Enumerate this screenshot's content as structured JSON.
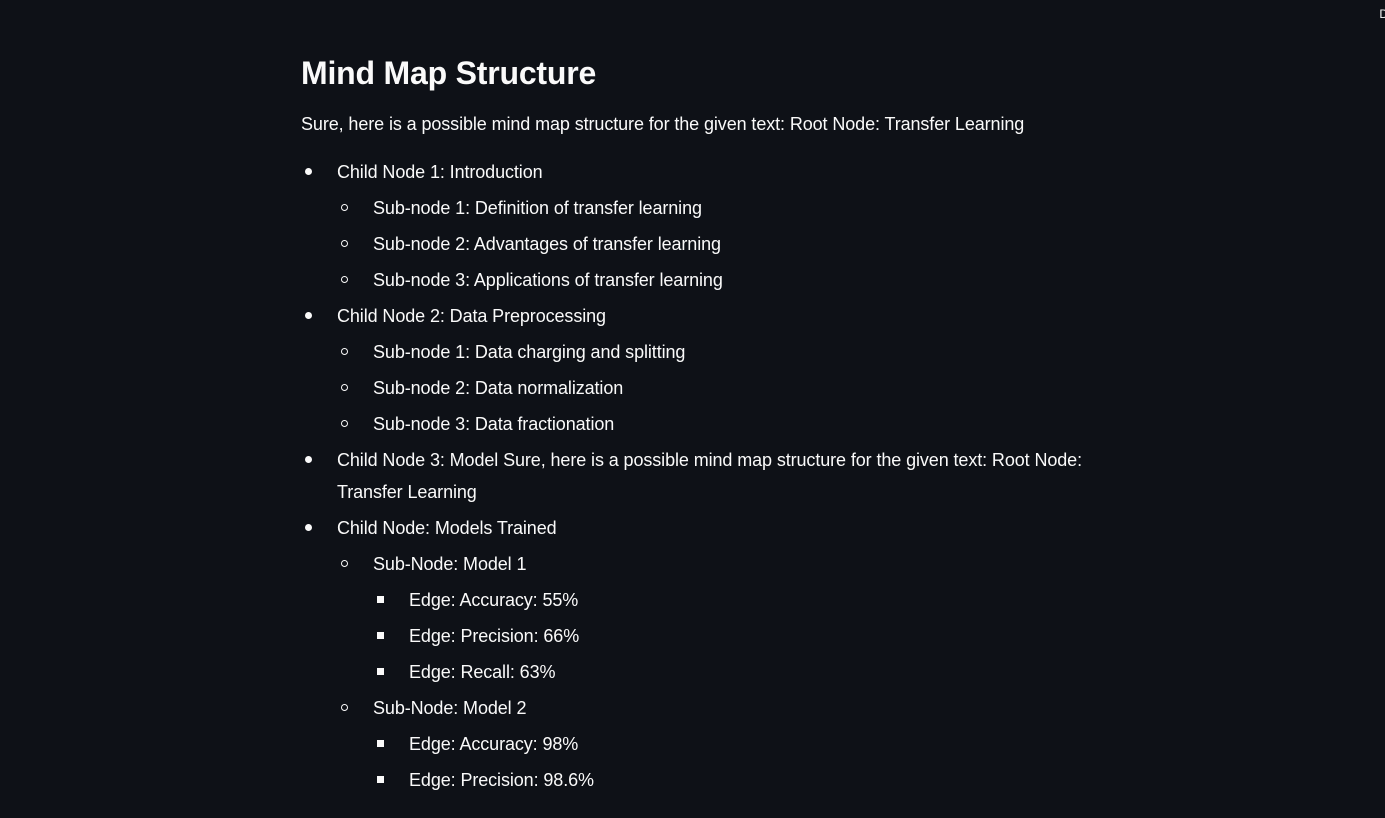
{
  "corner_glyph": "D",
  "title": "Mind Map Structure",
  "intro": "Sure, here is a possible mind map structure for the given text: Root Node: Transfer Learning",
  "nodes": [
    {
      "label": "Child Node 1: Introduction",
      "children": [
        {
          "label": "Sub-node 1: Definition of transfer learning"
        },
        {
          "label": "Sub-node 2: Advantages of transfer learning"
        },
        {
          "label": "Sub-node 3: Applications of transfer learning"
        }
      ]
    },
    {
      "label": "Child Node 2: Data Preprocessing",
      "children": [
        {
          "label": "Sub-node 1: Data charging and splitting"
        },
        {
          "label": "Sub-node 2: Data normalization"
        },
        {
          "label": "Sub-node 3: Data fractionation"
        }
      ]
    },
    {
      "label": "Child Node 3: Model Sure, here is a possible mind map structure for the given text: Root Node: Transfer Learning",
      "children": []
    },
    {
      "label": "Child Node: Models Trained",
      "children": [
        {
          "label": "Sub-Node: Model 1",
          "children": [
            {
              "label": "Edge: Accuracy: 55%"
            },
            {
              "label": "Edge: Precision: 66%"
            },
            {
              "label": "Edge: Recall: 63%"
            }
          ]
        },
        {
          "label": "Sub-Node: Model 2",
          "children": [
            {
              "label": "Edge: Accuracy: 98%"
            },
            {
              "label": "Edge: Precision: 98.6%"
            }
          ]
        }
      ]
    }
  ]
}
